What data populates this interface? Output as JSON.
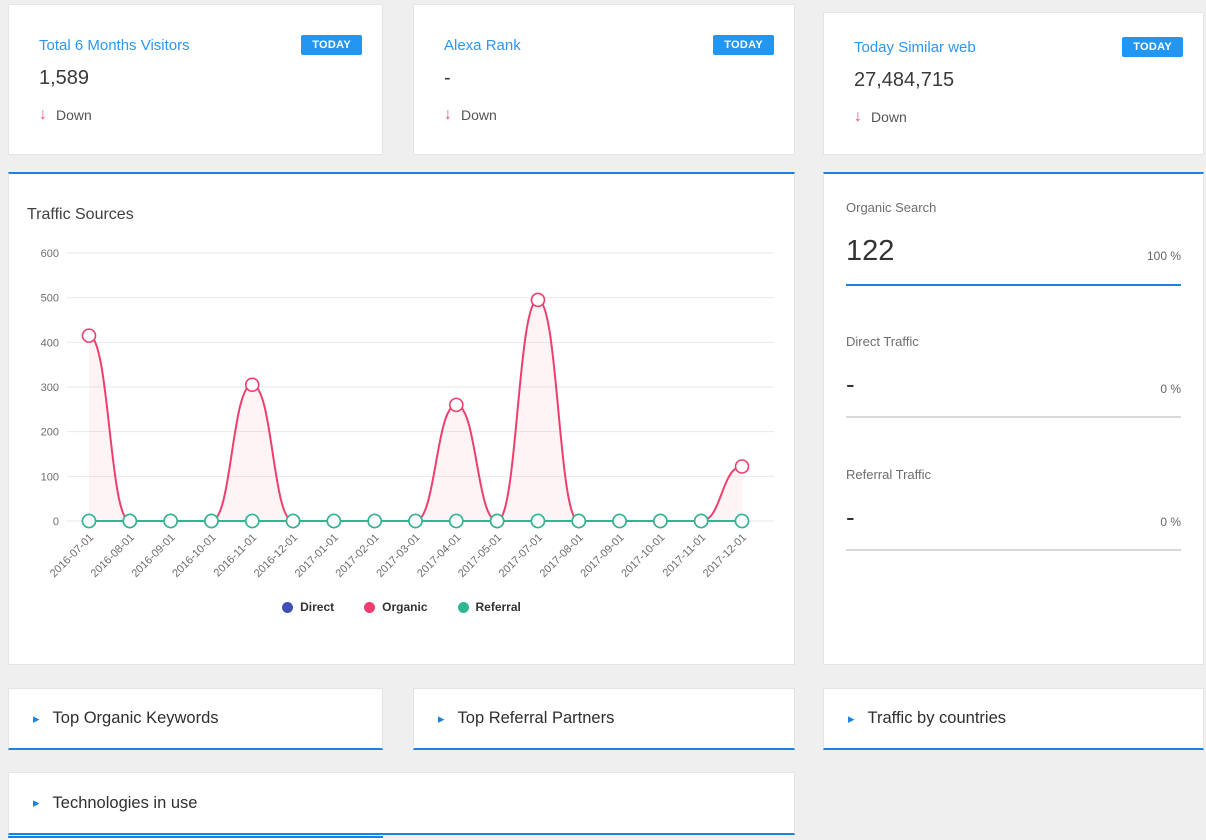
{
  "colors": {
    "accent_blue": "#1a82e2",
    "badge_blue": "#2196f3",
    "title_blue": "#2b97f1",
    "down_red": "#f4516c",
    "rule_gray": "#d9d9d9"
  },
  "icons": {
    "down_arrow": "↓",
    "expand_arrow": "▸"
  },
  "stat_cards": [
    {
      "title": "Total 6 Months Visitors",
      "badge": "TODAY",
      "value": "1,589",
      "trend": "Down"
    },
    {
      "title": "Alexa Rank",
      "badge": "TODAY",
      "value": "-",
      "trend": "Down"
    },
    {
      "title": "Today Similar web",
      "badge": "TODAY",
      "value": "27,484,715",
      "trend": "Down"
    }
  ],
  "traffic_panel": {
    "title": "Traffic Sources"
  },
  "chart_data": {
    "type": "line",
    "title": "Traffic Sources",
    "x": [
      "2016-07-01",
      "2016-08-01",
      "2016-09-01",
      "2016-10-01",
      "2016-11-01",
      "2016-12-01",
      "2017-01-01",
      "2017-02-01",
      "2017-03-01",
      "2017-04-01",
      "2017-05-01",
      "2017-07-01",
      "2017-08-01",
      "2017-09-01",
      "2017-10-01",
      "2017-11-01",
      "2017-12-01"
    ],
    "series": [
      {
        "name": "Direct",
        "color": "#3f51b5",
        "values": [
          0,
          0,
          0,
          0,
          0,
          0,
          0,
          0,
          0,
          0,
          0,
          0,
          0,
          0,
          0,
          0,
          0
        ]
      },
      {
        "name": "Organic",
        "color": "#ee3e6d",
        "fill": "rgba(238,62,109,0.06)",
        "values": [
          415,
          0,
          0,
          0,
          305,
          0,
          0,
          0,
          0,
          260,
          0,
          495,
          0,
          0,
          0,
          0,
          122
        ]
      },
      {
        "name": "Referral",
        "color": "#2fb792",
        "values": [
          0,
          0,
          0,
          0,
          0,
          0,
          0,
          0,
          0,
          0,
          0,
          0,
          0,
          0,
          0,
          0,
          0
        ]
      }
    ],
    "ylim": [
      0,
      600
    ],
    "yticks": [
      600,
      500,
      400,
      300,
      200,
      100,
      0
    ],
    "grid": true,
    "legend_position": "bottom"
  },
  "summary": {
    "rows": [
      {
        "title": "Organic Search",
        "value": "122",
        "percent": "100 %",
        "bar": "blue"
      },
      {
        "title": "Direct Traffic",
        "value": "-",
        "percent": "0 %",
        "bar": "gray"
      },
      {
        "title": "Referral Traffic",
        "value": "-",
        "percent": "0 %",
        "bar": "gray"
      }
    ]
  },
  "collapsed_panels": [
    {
      "title": "Top Organic Keywords"
    },
    {
      "title": "Top Referral Partners"
    },
    {
      "title": "Traffic by countries"
    }
  ],
  "technologies_panel": {
    "title": "Technologies in use"
  }
}
